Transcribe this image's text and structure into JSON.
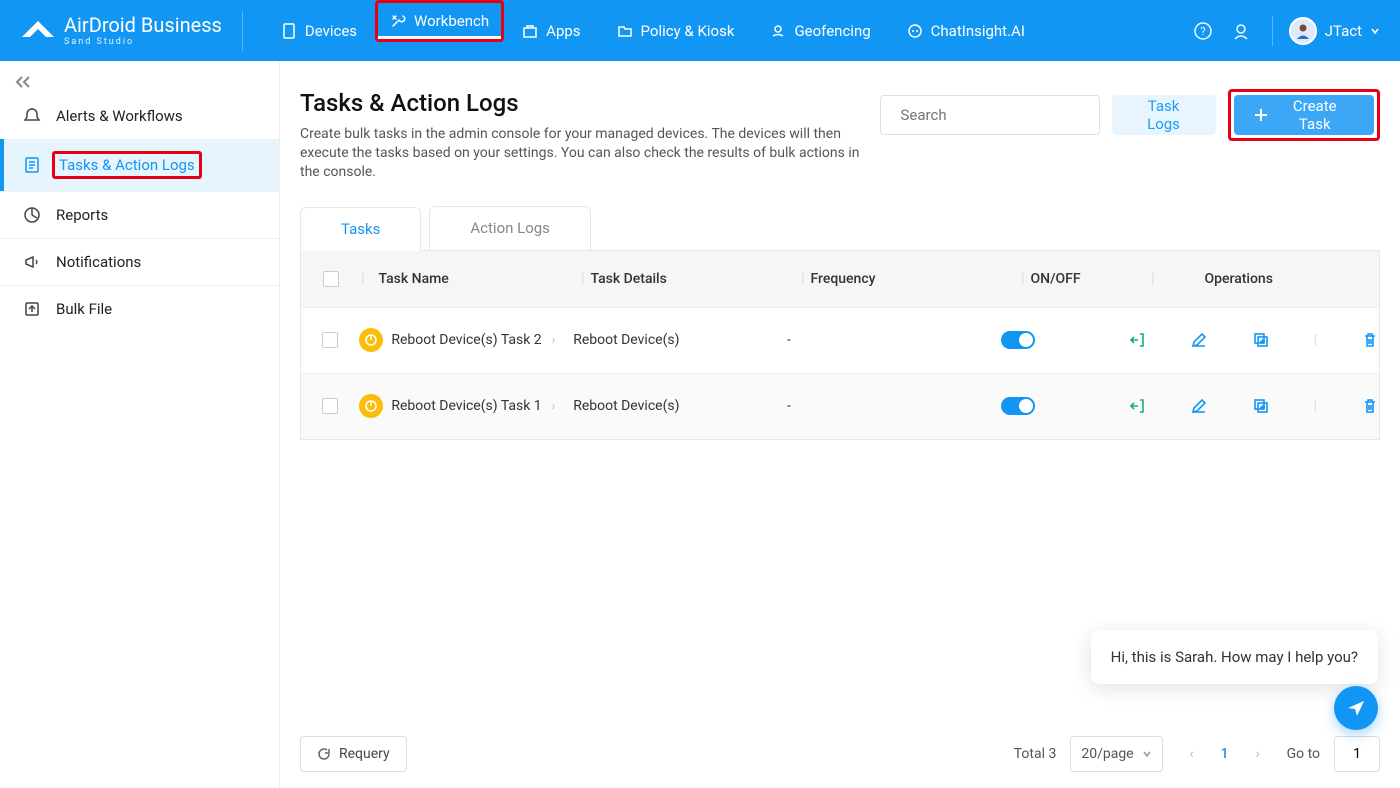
{
  "header": {
    "brand_main": "AirDroid Business",
    "brand_sub": "Sand Studio",
    "nav": [
      {
        "label": "Devices"
      },
      {
        "label": "Workbench",
        "active": true,
        "highlighted": true
      },
      {
        "label": "Apps"
      },
      {
        "label": "Policy & Kiosk"
      },
      {
        "label": "Geofencing"
      },
      {
        "label": "ChatInsight.AI"
      }
    ],
    "user_name": "JTact"
  },
  "sidebar": {
    "items": [
      {
        "label": "Alerts & Workflows"
      },
      {
        "label": "Tasks & Action Logs",
        "active": true,
        "highlighted": true
      },
      {
        "label": "Reports"
      },
      {
        "label": "Notifications"
      },
      {
        "label": "Bulk File"
      }
    ]
  },
  "page": {
    "title": "Tasks & Action Logs",
    "description": "Create bulk tasks in the admin console for your managed devices. The devices will then execute the tasks based on your settings. You can also check the results of bulk actions in the console.",
    "search_placeholder": "Search",
    "task_logs_btn": "Task Logs",
    "create_btn": "Create Task"
  },
  "tabs": [
    {
      "label": "Tasks",
      "active": true
    },
    {
      "label": "Action Logs"
    }
  ],
  "table": {
    "columns": {
      "name": "Task Name",
      "details": "Task Details",
      "freq": "Frequency",
      "onoff": "ON/OFF",
      "ops": "Operations"
    },
    "rows": [
      {
        "name": "Reboot Device(s) Task 2",
        "details": "Reboot Device(s)",
        "freq": "-",
        "on": true
      },
      {
        "name": "Reboot Device(s) Task 1",
        "details": "Reboot Device(s)",
        "freq": "-",
        "on": true
      }
    ]
  },
  "chat": {
    "message": "Hi, this is Sarah. How may I help you?"
  },
  "pager": {
    "requery": "Requery",
    "total_label": "Total 3",
    "pagesize": "20/page",
    "current": "1",
    "goto_label": "Go to",
    "goto_value": "1"
  }
}
